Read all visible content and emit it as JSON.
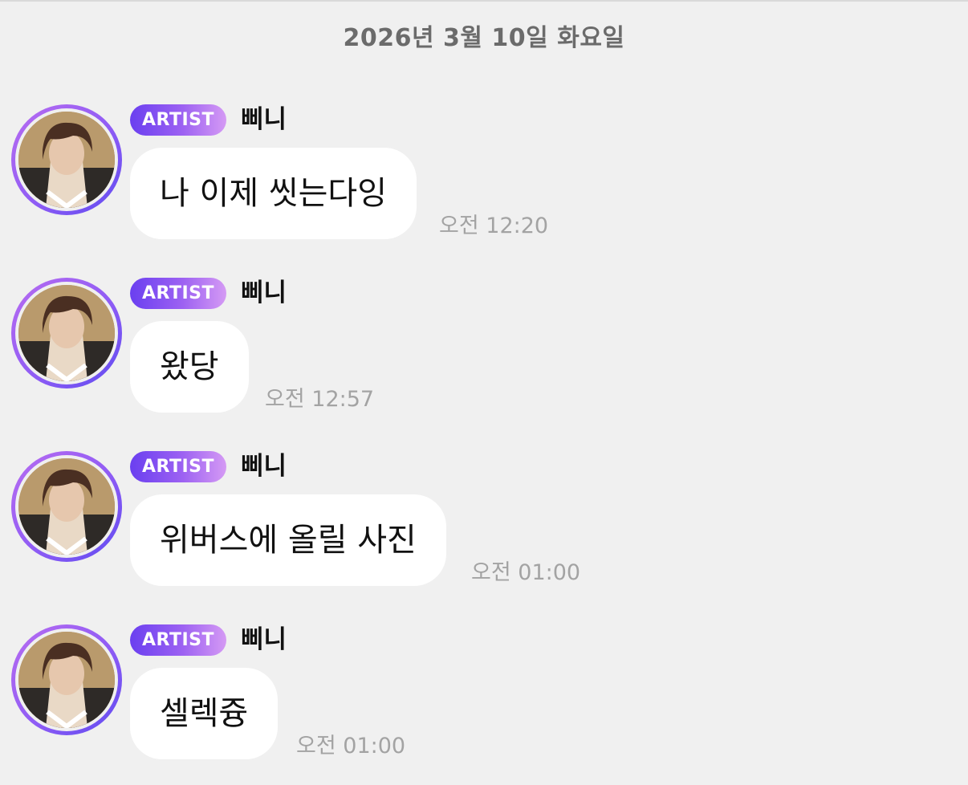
{
  "date_header": "2026년 3월 10일 화요일",
  "messages": [
    {
      "badge": "ARTIST",
      "sender": "삐니",
      "text": "나 이제 씻는다잉",
      "time": "오전 12:20"
    },
    {
      "badge": "ARTIST",
      "sender": "삐니",
      "text": "왔당",
      "time": "오전 12:57"
    },
    {
      "badge": "ARTIST",
      "sender": "삐니",
      "text": "위버스에 올릴 사진",
      "time": "오전 01:00"
    },
    {
      "badge": "ARTIST",
      "sender": "삐니",
      "text": "셀렉즁",
      "time": "오전 01:00"
    }
  ],
  "colors": {
    "background": "#f0f0f0",
    "bubble": "#ffffff",
    "badge_gradient_start": "#6a3ff0",
    "badge_gradient_end": "#d59af4",
    "timestamp": "#a3a3a3",
    "date_header": "#6b6b6b"
  },
  "icons": {
    "avatar": "artist-profile-photo"
  }
}
